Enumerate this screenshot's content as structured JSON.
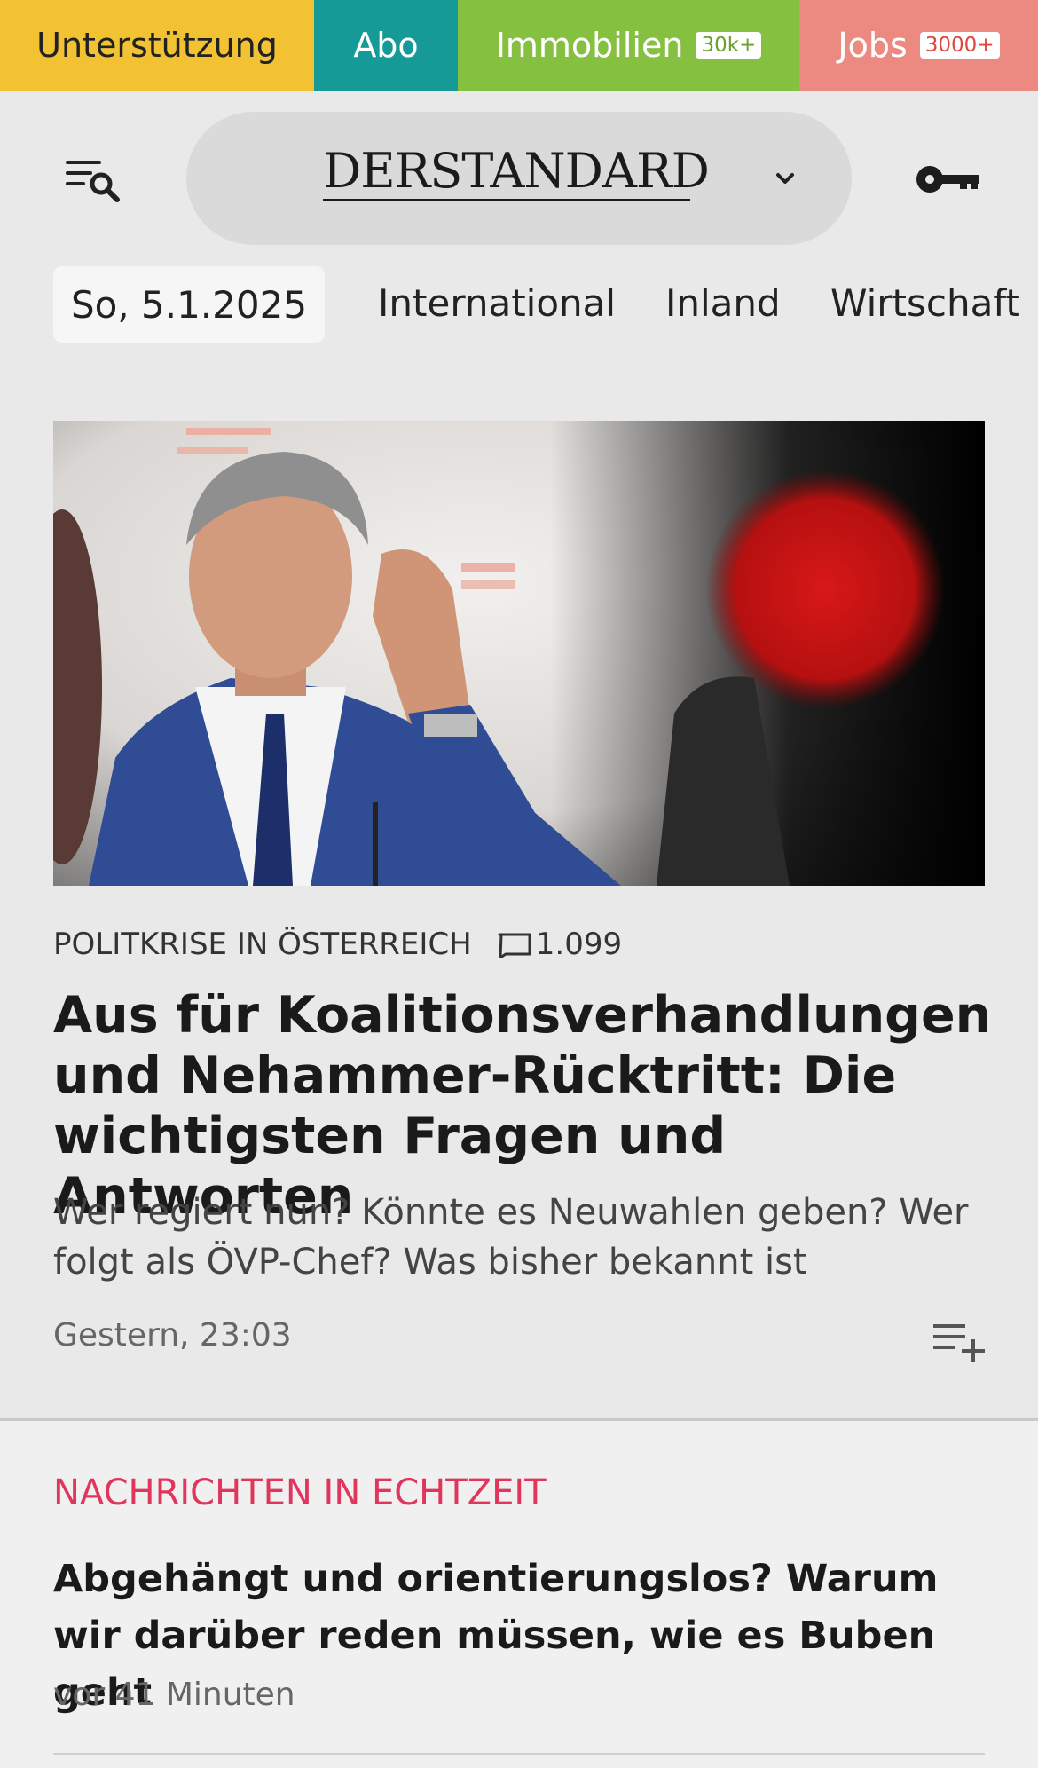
{
  "topbar": {
    "support": "Unterstützung",
    "abo": "Abo",
    "immobilien": "Immobilien",
    "immobilien_badge": "30k+",
    "jobs": "Jobs",
    "jobs_badge": "3000+"
  },
  "header": {
    "logo": "DERSTANDARD",
    "menu_icon": "menu-search-icon",
    "key_icon": "key-icon",
    "chevron_icon": "chevron-down-icon"
  },
  "nav": {
    "date": "So, 5.1.2025",
    "items": [
      "International",
      "Inland",
      "Wirtschaft"
    ]
  },
  "hero": {
    "kicker": "POLITKRISE IN ÖSTERREICH",
    "comments": "1.099",
    "headline": "Aus für Koalitionsverhandlungen und Nehammer-Rücktritt: Die wichtigsten Fragen und Antworten",
    "teaser": "Wer regiert nun? Könnte es Neuwahlen geben? Wer folgt als ÖVP-Chef? Was bisher bekannt ist",
    "time": "Gestern, 23:03"
  },
  "live": {
    "title": "NACHRICHTEN IN ECHTZEIT",
    "article_title": "Abgehängt und orientierungslos? Warum wir darüber reden müssen, wie es Buben geht",
    "article_time": "vor 41 Minuten"
  },
  "colors": {
    "support": "#f2c233",
    "abo": "#169a98",
    "immobilien": "#85c040",
    "jobs": "#ec8980",
    "live_accent": "#e0365e"
  }
}
